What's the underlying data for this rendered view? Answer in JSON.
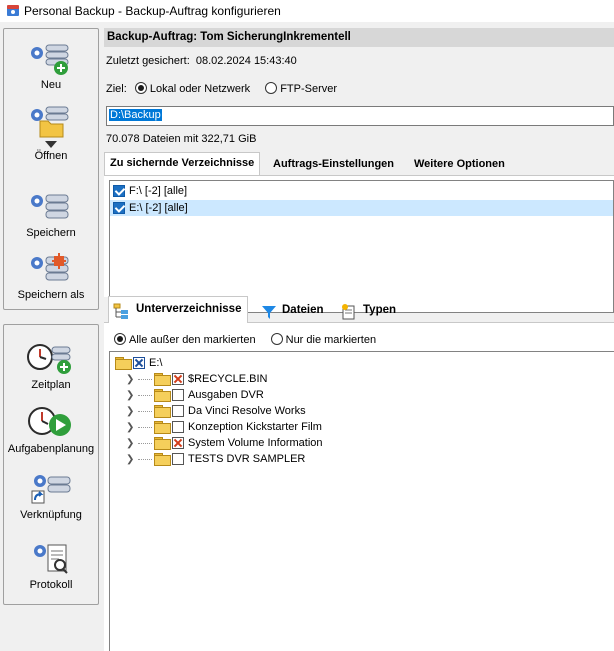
{
  "window": {
    "title": "Personal Backup - Backup-Auftrag konfigurieren",
    "icon": "backup-app-icon"
  },
  "sidebar_top": [
    {
      "label": "Neu",
      "icon": "new-task-icon"
    },
    {
      "label": "Öffnen",
      "icon": "open-task-icon"
    },
    {
      "label": "Speichern",
      "icon": "save-task-icon"
    },
    {
      "label": "Speichern als",
      "icon": "save-as-task-icon"
    }
  ],
  "sidebar_bottom": [
    {
      "label": "Zeitplan",
      "icon": "schedule-icon"
    },
    {
      "label": "Aufgabenplanung",
      "icon": "task-scheduler-icon"
    },
    {
      "label": "Verknüpfung",
      "icon": "shortcut-icon"
    },
    {
      "label": "Protokoll",
      "icon": "log-icon"
    }
  ],
  "header": {
    "title": "Backup-Auftrag: Tom SicherungInkrementell"
  },
  "last_saved": {
    "label": "Zuletzt gesichert:",
    "value": "08.02.2024 15:43:40"
  },
  "target": {
    "label": "Ziel:",
    "options": [
      "Lokal oder Netzwerk",
      "FTP-Server"
    ],
    "selected": "Lokal oder Netzwerk",
    "path": "D:\\Backup"
  },
  "file_info": "70.078 Dateien mit 322,71 GiB",
  "tabs": [
    "Zu sichernde Verzeichnisse",
    "Auftrags-Einstellungen",
    "Weitere Optionen"
  ],
  "active_tab": "Zu sichernde Verzeichnisse",
  "directories": [
    {
      "label": "F:\\ [-2] [alle]",
      "checked": true,
      "selected": false
    },
    {
      "label": "E:\\ [-2] [alle]",
      "checked": true,
      "selected": true
    }
  ],
  "subtabs": [
    {
      "label": "Unterverzeichnisse",
      "icon": "subfolders-icon"
    },
    {
      "label": "Dateien",
      "icon": "filter-icon"
    },
    {
      "label": "Typen",
      "icon": "file-types-icon"
    }
  ],
  "active_subtab": "Unterverzeichnisse",
  "filter_mode": {
    "options": [
      "Alle außer den markierten",
      "Nur die markierten"
    ],
    "selected": "Alle außer den markierten"
  },
  "tree": {
    "root": "E:\\",
    "children": [
      {
        "label": "$RECYCLE.BIN",
        "marked": true
      },
      {
        "label": "Ausgaben DVR",
        "marked": false
      },
      {
        "label": "Da Vinci Resolve Works",
        "marked": false
      },
      {
        "label": "Konzeption Kickstarter Film",
        "marked": false
      },
      {
        "label": "System Volume Information",
        "marked": true
      },
      {
        "label": "TESTS DVR SAMPLER",
        "marked": false
      }
    ]
  }
}
